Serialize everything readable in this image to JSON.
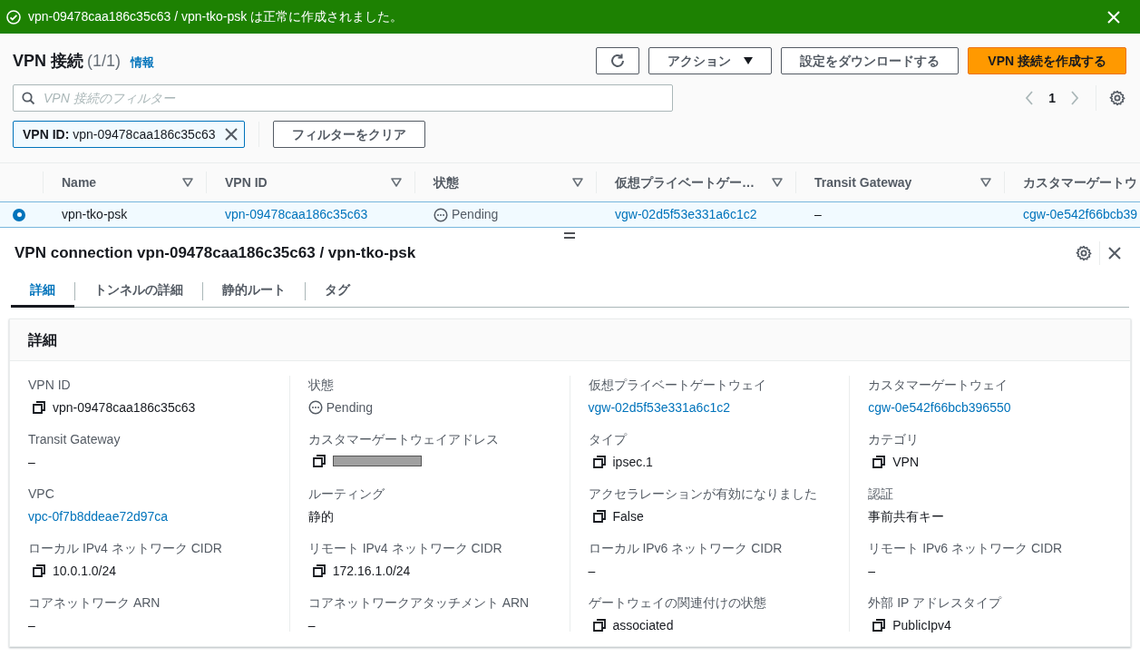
{
  "flash": {
    "kind": "success",
    "message": "vpn-09478caa186c35c63 / vpn-tko-psk は正常に作成されました。"
  },
  "header": {
    "title": "VPN 接続",
    "count": "(1/1)",
    "info": "情報"
  },
  "actions": [
    {
      "kind": "refresh"
    },
    {
      "kind": "dropdown",
      "label": "アクション"
    },
    {
      "kind": "normal",
      "label": "設定をダウンロードする"
    },
    {
      "kind": "primary",
      "label": "VPN 接続を作成する"
    }
  ],
  "filter": {
    "placeholder": "VPN 接続のフィルター"
  },
  "pagination": {
    "page": "1"
  },
  "tokens": [
    {
      "key": "VPN ID:",
      "value": "vpn-09478caa186c35c63"
    }
  ],
  "clear_filters": "フィルターをクリア",
  "table": {
    "columns": [
      "Name",
      "VPN ID",
      "状態",
      "仮想プライベートゲー…",
      "Transit Gateway",
      "カスタマーゲートウ"
    ],
    "rows": [
      {
        "selected": true,
        "cells": [
          {
            "kind": "text",
            "text": "vpn-tko-psk"
          },
          {
            "kind": "link",
            "text": "vpn-09478caa186c35c63"
          },
          {
            "kind": "status",
            "text": "Pending"
          },
          {
            "kind": "link",
            "text": "vgw-02d5f53e331a6c1c2"
          },
          {
            "kind": "text",
            "text": "–"
          },
          {
            "kind": "link",
            "text": "cgw-0e542f66bcb39"
          }
        ]
      }
    ]
  },
  "detail": {
    "title": "VPN connection vpn-09478caa186c35c63 / vpn-tko-psk",
    "tabs": [
      {
        "label": "詳細",
        "selected": true
      },
      {
        "label": "トンネルの詳細",
        "selected": false
      },
      {
        "label": "静的ルート",
        "selected": false
      },
      {
        "label": "タグ",
        "selected": false
      }
    ],
    "section_title": "詳細",
    "columns": [
      [
        {
          "label": "VPN ID",
          "kind": "copy",
          "value": "vpn-09478caa186c35c63"
        },
        {
          "label": "Transit Gateway",
          "kind": "text",
          "value": "–"
        },
        {
          "label": "VPC",
          "kind": "link",
          "value": "vpc-0f7b8ddeae72d97ca"
        },
        {
          "label": "ローカル IPv4 ネットワーク CIDR",
          "kind": "copy",
          "value": "10.0.1.0/24"
        },
        {
          "label": "コアネットワーク ARN",
          "kind": "text",
          "value": "–"
        }
      ],
      [
        {
          "label": "状態",
          "kind": "status",
          "value": "Pending"
        },
        {
          "label": "カスタマーゲートウェイアドレス",
          "kind": "redacted"
        },
        {
          "label": "ルーティング",
          "kind": "text",
          "value": "静的"
        },
        {
          "label": "リモート IPv4 ネットワーク CIDR",
          "kind": "copy",
          "value": "172.16.1.0/24"
        },
        {
          "label": "コアネットワークアタッチメント ARN",
          "kind": "text",
          "value": "–"
        }
      ],
      [
        {
          "label": "仮想プライベートゲートウェイ",
          "kind": "link",
          "value": "vgw-02d5f53e331a6c1c2"
        },
        {
          "label": "タイプ",
          "kind": "copy",
          "value": "ipsec.1"
        },
        {
          "label": "アクセラレーションが有効になりました",
          "kind": "copy",
          "value": "False"
        },
        {
          "label": "ローカル IPv6 ネットワーク CIDR",
          "kind": "text",
          "value": "–"
        },
        {
          "label": "ゲートウェイの関連付けの状態",
          "kind": "copy",
          "value": "associated"
        }
      ],
      [
        {
          "label": "カスタマーゲートウェイ",
          "kind": "link",
          "value": "cgw-0e542f66bcb396550"
        },
        {
          "label": "カテゴリ",
          "kind": "copy",
          "value": "VPN"
        },
        {
          "label": "認証",
          "kind": "text",
          "value": "事前共有キー"
        },
        {
          "label": "リモート IPv6 ネットワーク CIDR",
          "kind": "text",
          "value": "–"
        },
        {
          "label": "外部 IP アドレスタイプ",
          "kind": "copy",
          "value": "PublicIpv4"
        }
      ]
    ]
  }
}
